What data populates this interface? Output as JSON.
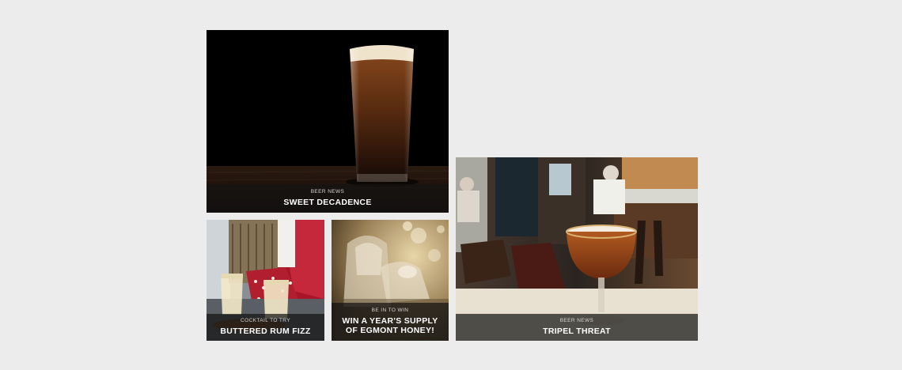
{
  "cards": [
    {
      "tag": "BEER NEWS",
      "title": "SWEET DECADENCE"
    },
    {
      "tag": "COCKTAIL TO TRY",
      "title": "BUTTERED RUM FIZZ"
    },
    {
      "tag": "BE IN TO WIN",
      "title": "WIN A YEAR'S SUPPLY OF EGMONT HONEY!"
    },
    {
      "tag": "BEER NEWS",
      "title": "TRIPEL THREAT"
    }
  ]
}
